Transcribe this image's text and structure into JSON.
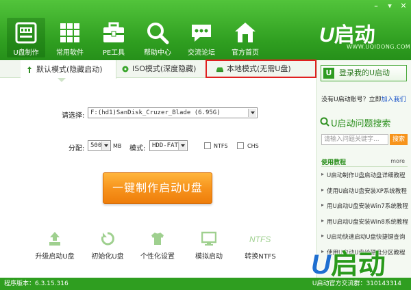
{
  "window": {
    "controls": [
      "–",
      "▾",
      "✕"
    ]
  },
  "nav": [
    {
      "label": "U盘制作",
      "icon": "usb-drive-icon",
      "active": true
    },
    {
      "label": "常用软件",
      "icon": "apps-grid-icon"
    },
    {
      "label": "PE工具",
      "icon": "toolbox-icon"
    },
    {
      "label": "帮助中心",
      "icon": "magnifier-icon"
    },
    {
      "label": "交流论坛",
      "icon": "chat-bubble-icon"
    },
    {
      "label": "官方首页",
      "icon": "home-icon"
    }
  ],
  "logo": {
    "u": "U",
    "name": "启动",
    "url": "WWW.UQIDONG.COM"
  },
  "tabs": [
    {
      "label": "默认模式(隐藏启动)",
      "icon": "arrows-icon"
    },
    {
      "label": "ISO模式(深度隐藏)",
      "icon": "disc-icon"
    },
    {
      "label": "本地模式(无需U盘)",
      "icon": "drive-icon"
    }
  ],
  "form": {
    "select_label": "请选择:",
    "drive_value": "F:(hd1)SanDisk_Cruzer_Blade (6.95G)",
    "alloc_label": "分配:",
    "alloc_value": "500",
    "alloc_unit": "MB",
    "mode_label": "模式:",
    "mode_value": "HDD-FAT32",
    "ntfs_label": "NTFS",
    "chs_label": "CHS"
  },
  "make_button": "一键制作启动U盘",
  "tools": [
    {
      "label": "升级启动U盘",
      "icon": "upgrade-icon"
    },
    {
      "label": "初始化U盘",
      "icon": "refresh-icon"
    },
    {
      "label": "个性化设置",
      "icon": "shirt-icon"
    },
    {
      "label": "模拟启动",
      "icon": "monitor-icon"
    },
    {
      "label": "转换NTFS",
      "icon": "ntfs-icon"
    }
  ],
  "sidebar": {
    "login": "登录我的U启动",
    "login_badge": "U",
    "account_prefix": "没有U启动账号？立即",
    "join_link": "加入我们",
    "search_title": "U启动问题搜索",
    "search_placeholder": "请输入问题关键字...",
    "search_button": "搜索",
    "tutorial_title": "使用教程",
    "more": "more",
    "tutorials": [
      "U启动制作U盘启动盘详细教程",
      "使用U启动U盘安装XP系统教程",
      "用U启动U盘安装Win7系统教程",
      "用U启动U盘安装Win8系统教程",
      "U启动快速启动U盘快捷键查询",
      "使用U启动U盘给硬盘分区教程"
    ],
    "big_logo_u": "U",
    "big_logo_name": "启动"
  },
  "status": {
    "version": "程序版本：6.3.15.316",
    "qq": "U启动官方交流群：310143314"
  },
  "colors": {
    "brand_green": "#2f9e20",
    "accent_orange": "#f7941d",
    "highlight_red": "#e02020"
  }
}
